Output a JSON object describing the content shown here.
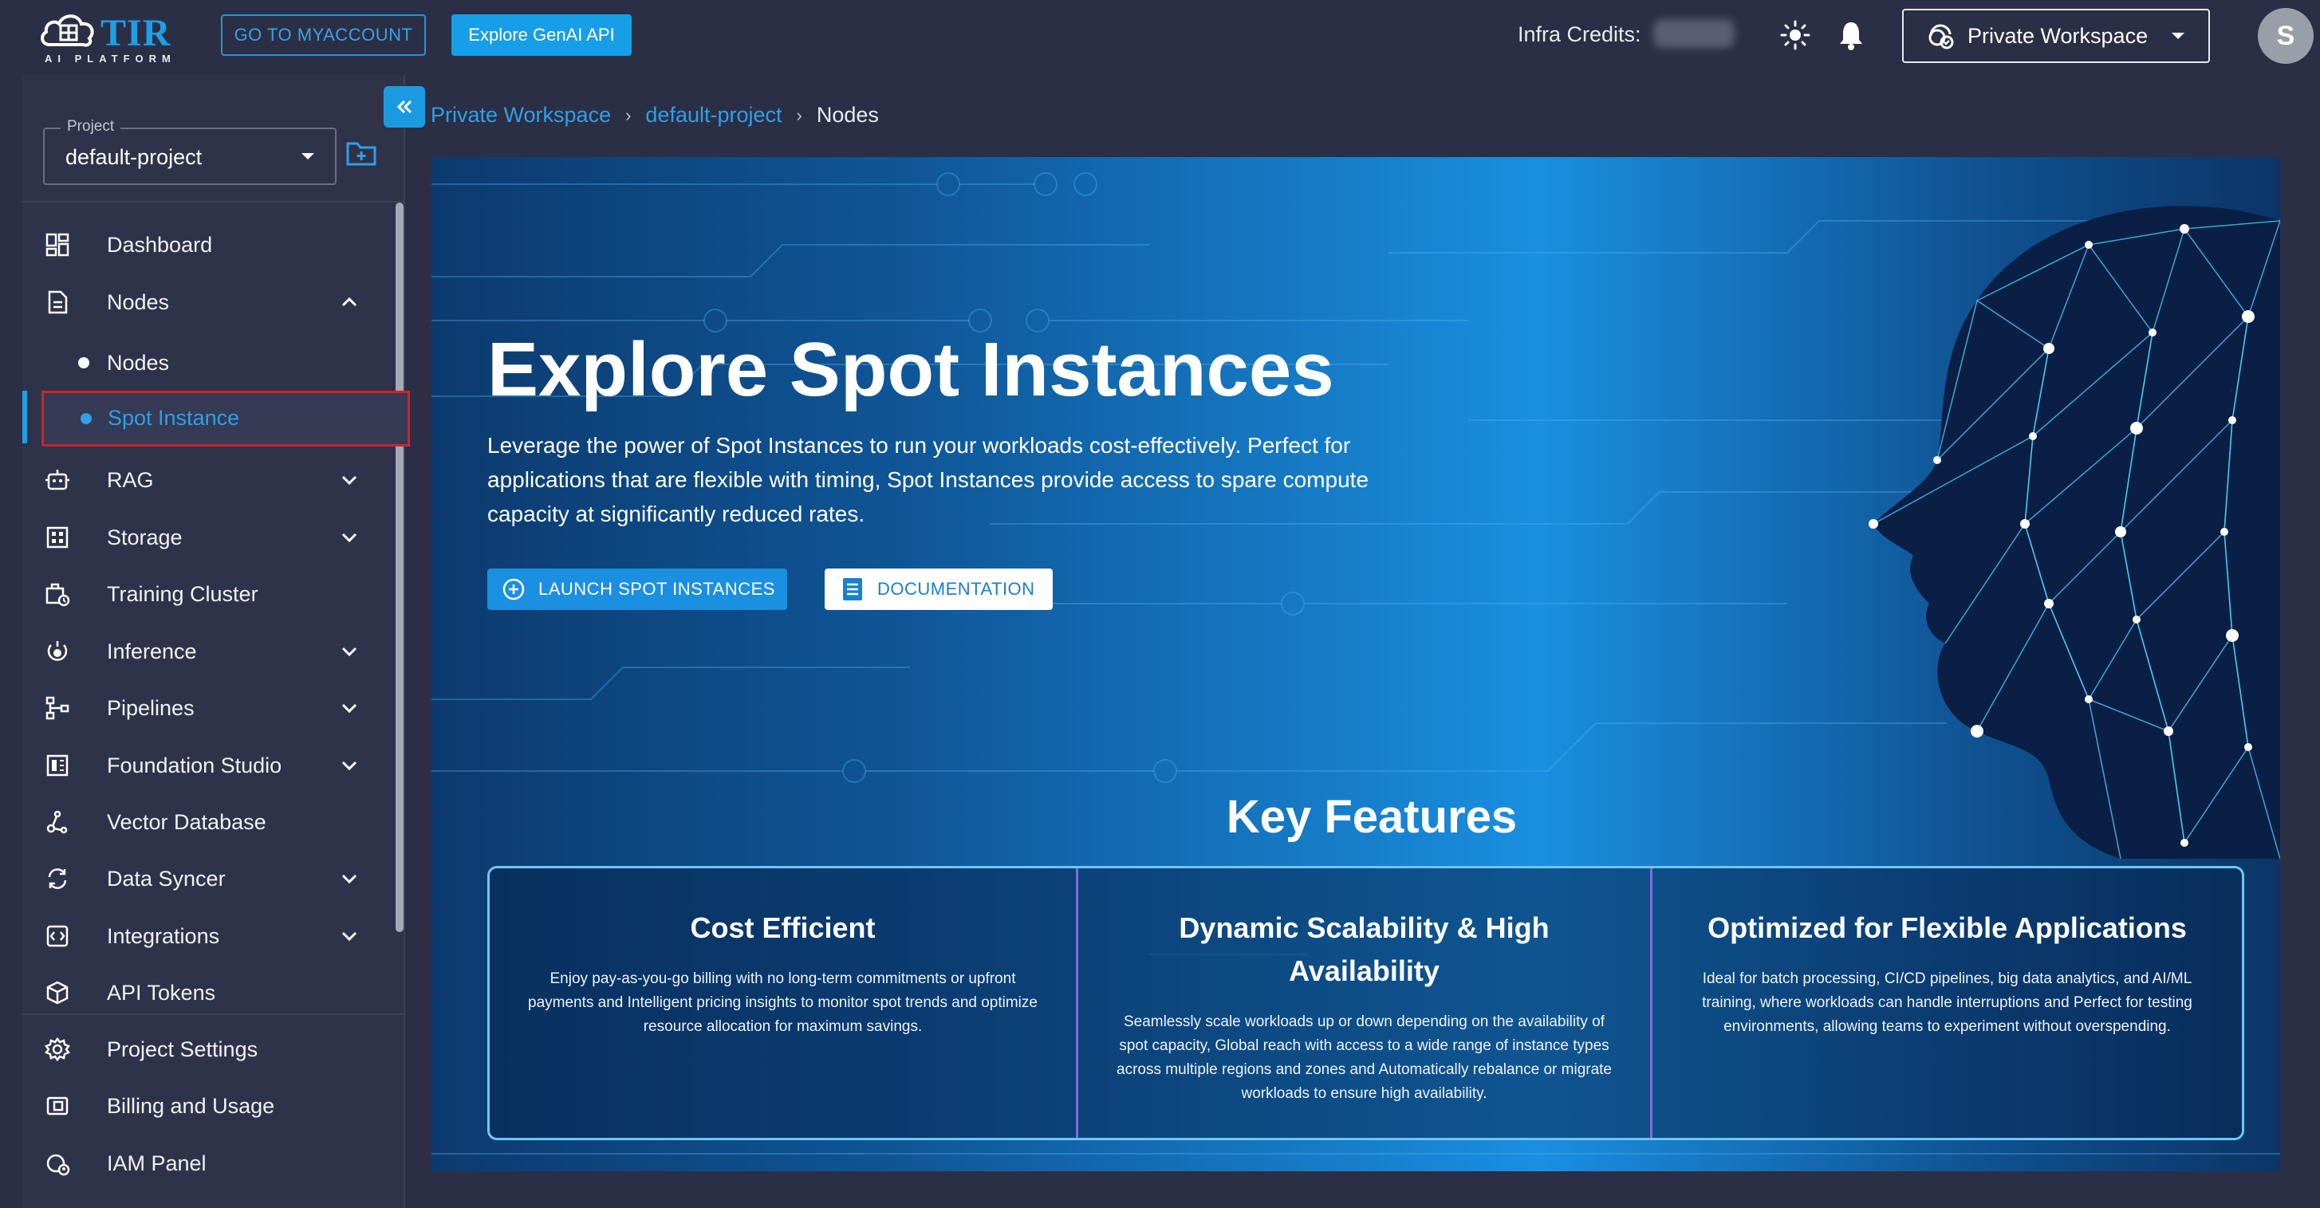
{
  "brand": {
    "name": "TIR",
    "tagline": "AI PLATFORM"
  },
  "header": {
    "myaccount_label": "GO TO MYACCOUNT",
    "genai_label": "Explore GenAI API",
    "credits_label": "Infra Credits:",
    "workspace_label": "Private Workspace",
    "avatar_initial": "S"
  },
  "sidebar": {
    "project_legend": "Project",
    "project_value": "default-project",
    "items": [
      {
        "label": "Dashboard",
        "icon": "dashboard-icon",
        "chevron": "none"
      },
      {
        "label": "Nodes",
        "icon": "document-icon",
        "chevron": "up"
      },
      {
        "label": "Nodes",
        "icon": "dot",
        "chevron": "none",
        "sub": true
      },
      {
        "label": "Spot Instance",
        "icon": "dot",
        "chevron": "none",
        "sub": true,
        "active": true
      },
      {
        "label": "RAG",
        "icon": "robot-icon",
        "chevron": "down"
      },
      {
        "label": "Storage",
        "icon": "storage-icon",
        "chevron": "down"
      },
      {
        "label": "Training Cluster",
        "icon": "cluster-icon",
        "chevron": "none"
      },
      {
        "label": "Inference",
        "icon": "inference-icon",
        "chevron": "down"
      },
      {
        "label": "Pipelines",
        "icon": "pipeline-icon",
        "chevron": "down"
      },
      {
        "label": "Foundation Studio",
        "icon": "studio-icon",
        "chevron": "down"
      },
      {
        "label": "Vector Database",
        "icon": "vector-icon",
        "chevron": "none"
      },
      {
        "label": "Data Syncer",
        "icon": "sync-icon",
        "chevron": "down"
      },
      {
        "label": "Integrations",
        "icon": "integration-icon",
        "chevron": "down"
      },
      {
        "label": "API Tokens",
        "icon": "token-icon",
        "chevron": "none"
      },
      {
        "label": "Project Settings",
        "icon": "gear-icon",
        "chevron": "none"
      },
      {
        "label": "Billing and Usage",
        "icon": "wallet-icon",
        "chevron": "none"
      },
      {
        "label": "IAM Panel",
        "icon": "iam-icon",
        "chevron": "none"
      }
    ]
  },
  "breadcrumb": [
    "Private Workspace",
    "default-project",
    "Nodes"
  ],
  "hero": {
    "title": "Explore Spot Instances",
    "description": "Leverage the power of Spot Instances to run your workloads cost-effectively. Perfect for applications that are flexible with timing, Spot Instances provide access to spare compute capacity at significantly reduced rates.",
    "launch_label": "LAUNCH SPOT INSTANCES",
    "docs_label": "DOCUMENTATION"
  },
  "features": {
    "title": "Key Features",
    "cards": [
      {
        "title": "Cost Efficient",
        "text": "Enjoy pay-as-you-go billing with no long-term commitments or upfront payments and Intelligent pricing insights to monitor spot trends and optimize resource allocation for maximum savings."
      },
      {
        "title": "Dynamic Scalability & High Availability",
        "text": "Seamlessly scale workloads up or down depending on the availability of spot capacity, Global reach with access to a wide range of instance types across multiple regions and zones and Automatically rebalance or migrate workloads to ensure high availability."
      },
      {
        "title": "Optimized for Flexible Applications",
        "text": "Ideal for batch processing, CI/CD pipelines, big data analytics, and AI/ML training, where workloads can handle interruptions and Perfect for testing environments, allowing teams to experiment without overspending."
      }
    ]
  },
  "colors": {
    "accent": "#1e9fe6",
    "active_outline": "#d0232a",
    "background": "#2b2f45"
  }
}
